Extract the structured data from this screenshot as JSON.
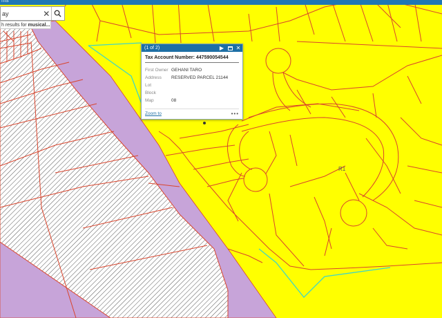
{
  "topbar": {
    "text": "ms"
  },
  "search": {
    "value": "ay",
    "suggestion_prefix": "h results for ",
    "suggestion_term": "musical..."
  },
  "popup": {
    "count": "(1 of 2)",
    "title": "Tax Account Number: 447590054544",
    "rows": [
      {
        "field": "First Owner",
        "value": "GEHANI TARO"
      },
      {
        "field": "Address",
        "value": "RESERVED PARCEL 21144"
      },
      {
        "field": "Lot",
        "value": ""
      },
      {
        "field": "Block",
        "value": ""
      },
      {
        "field": "Map",
        "value": "08"
      }
    ],
    "zoom_label": "Zoom to",
    "more_label": "•••"
  },
  "map": {
    "zone_label": "R1"
  },
  "colors": {
    "zone_fill": "#ffff00",
    "parkland_fill": "#c7a4d9",
    "hatched_fill": "#ffffff",
    "parcel_line": "#d9442c",
    "selection_line": "#3fd6c6",
    "header_blue": "#1d6fa5"
  },
  "icons": [
    "search-icon",
    "close-icon",
    "next-arrow-icon",
    "maximize-icon",
    "more-icon"
  ]
}
